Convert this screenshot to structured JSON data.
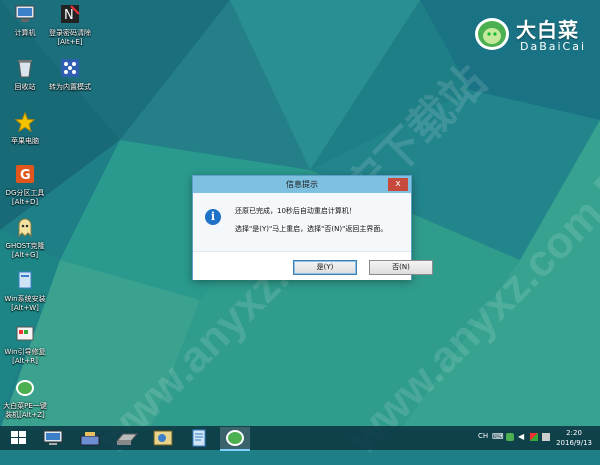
{
  "watermark": "www.anyxz.com 安下载站",
  "logo": {
    "text": "大白菜",
    "subtext": "DaBaiCai"
  },
  "desktop_icons": [
    {
      "id": "computer",
      "label": "计算机"
    },
    {
      "id": "login",
      "label": "登录密码清除\n[Alt+E]"
    },
    {
      "id": "recycle",
      "label": "回收站"
    },
    {
      "id": "transfer",
      "label": "转为内置模式"
    },
    {
      "id": "apple",
      "label": "苹果电脑"
    },
    {
      "id": "dg",
      "label": "DG分区工具\n[Alt+D]"
    },
    {
      "id": "ghost",
      "label": "GHOST克隆\n[Alt+G]"
    },
    {
      "id": "winsetup",
      "label": "Win系统安装\n[Alt+W]"
    },
    {
      "id": "winrepair",
      "label": "Win引导修复\n[Alt+R]"
    },
    {
      "id": "onekey",
      "label": "大白菜PE一键\n装机[Alt+Z]"
    }
  ],
  "dialog": {
    "title": "信息提示",
    "close": "x",
    "message1": "还原已完成，10秒后自动重启计算机！",
    "message2": "选择\"是(Y)\"马上重启，选择\"否(N)\"返回主界面。",
    "yes": "是(Y)",
    "no": "否(N)"
  },
  "tray": {
    "lang": "CH",
    "time": "2:20",
    "date": "2016/9/13"
  }
}
